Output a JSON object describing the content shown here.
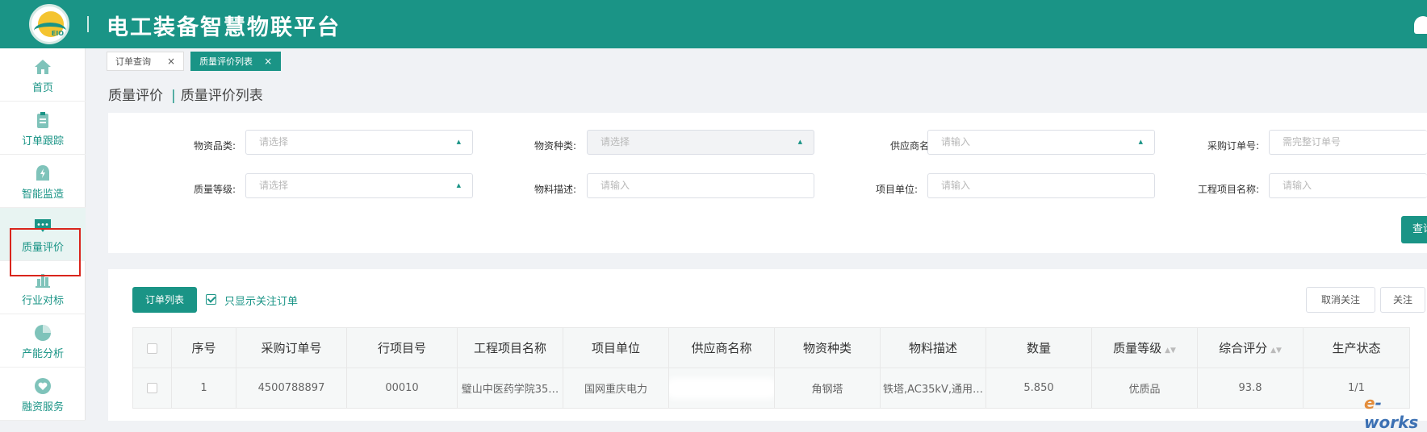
{
  "header": {
    "title": "电工装备智慧物联平台"
  },
  "sidebar": {
    "items": [
      {
        "label": "首页",
        "icon": "home-icon"
      },
      {
        "label": "订单跟踪",
        "icon": "clipboard-icon"
      },
      {
        "label": "智能监造",
        "icon": "lightning-icon"
      },
      {
        "label": "质量评价",
        "icon": "chat-bubble-icon",
        "active": true
      },
      {
        "label": "行业对标",
        "icon": "bar-chart-icon"
      },
      {
        "label": "产能分析",
        "icon": "pie-chart-icon"
      },
      {
        "label": "融资服务",
        "icon": "heart-icon"
      }
    ]
  },
  "tabs": [
    {
      "label": "订单查询",
      "active": false
    },
    {
      "label": "质量评价列表",
      "active": true
    }
  ],
  "breadcrumb": {
    "parent": "质量评价",
    "current": "质量评价列表"
  },
  "filters": {
    "material_category": {
      "label": "物资品类:",
      "placeholder": "请选择"
    },
    "material_type": {
      "label": "物资种类:",
      "placeholder": "请选择"
    },
    "supplier_name": {
      "label": "供应商名称:",
      "placeholder": "请输入"
    },
    "po_number": {
      "label": "采购订单号:",
      "placeholder": "需完整订单号"
    },
    "quality_grade": {
      "label": "质量等级:",
      "placeholder": "请选择"
    },
    "material_desc": {
      "label": "物料描述:",
      "placeholder": "请输入"
    },
    "project_unit": {
      "label": "项目单位:",
      "placeholder": "请输入"
    },
    "project_name": {
      "label": "工程项目名称:",
      "placeholder": "请输入"
    },
    "query_button": "查询"
  },
  "toolbar": {
    "orders_button": "订单列表",
    "only_followed": "只显示关注订单",
    "unfollow_button": "取消关注",
    "follow_button": "关注"
  },
  "table": {
    "columns": [
      "序号",
      "采购订单号",
      "行项目号",
      "工程项目名称",
      "项目单位",
      "供应商名称",
      "物资种类",
      "物料描述",
      "数量",
      "质量等级",
      "综合评分",
      "生产状态"
    ],
    "rows": [
      {
        "index": "1",
        "po_number": "4500788897",
        "line_item": "00010",
        "project_name": "璧山中医药学院35…",
        "project_unit": "国网重庆电力",
        "supplier_name": "",
        "material_type": "角钢塔",
        "material_desc": "铁塔,AC35kV,通用…",
        "quantity": "5.850",
        "quality_grade": "优质品",
        "score": "93.8",
        "production_status": "1/1"
      }
    ]
  },
  "colors": {
    "brand": "#1a9486",
    "highlight_border": "#d9251c"
  }
}
